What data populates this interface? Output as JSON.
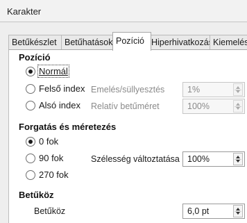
{
  "window": {
    "title": "Karakter"
  },
  "tabs": [
    {
      "label": "Betűkészlet",
      "active": false
    },
    {
      "label": "Betűhatások",
      "active": false
    },
    {
      "label": "Pozíció",
      "active": true
    },
    {
      "label": "Hiperhivatkozás",
      "active": false
    },
    {
      "label": "Kiemelés",
      "active": false
    }
  ],
  "position": {
    "title": "Pozíció",
    "options": [
      {
        "label": "Normál",
        "checked": true
      },
      {
        "label": "Felső index",
        "checked": false
      },
      {
        "label": "Alsó index",
        "checked": false
      }
    ],
    "raise_label": "Emelés/süllyesztés",
    "raise_value": "1%",
    "rel_size_label": "Relatív betűméret",
    "rel_size_value": "100%"
  },
  "rotation": {
    "title": "Forgatás és méretezés",
    "options": [
      {
        "label": "0 fok",
        "checked": true
      },
      {
        "label": "90 fok",
        "checked": false
      },
      {
        "label": "270 fok",
        "checked": false
      }
    ],
    "scale_label": "Szélesség változtatása",
    "scale_value": "100%"
  },
  "spacing": {
    "title": "Betűköz",
    "label": "Betűköz",
    "value": "6,0 pt"
  },
  "colors": {
    "dialog_bg": "#eeeeee",
    "panel_bg": "#ffffff",
    "disabled_text": "#8a8a8a"
  }
}
